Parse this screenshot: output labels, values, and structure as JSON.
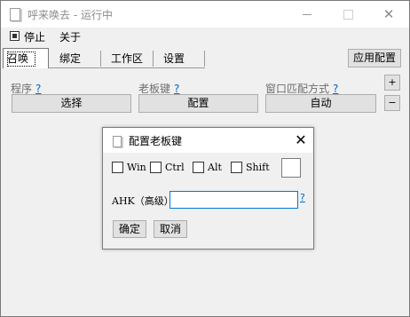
{
  "window": {
    "title": "呼来唤去 - 运行中"
  },
  "menu": {
    "items": [
      "停止",
      "关于"
    ]
  },
  "tabs": [
    "召唤",
    "绑定",
    "工作区",
    "设置"
  ],
  "toolbar": {
    "apply_label": "应用配置",
    "add_label": "+",
    "remove_label": "−"
  },
  "fields": {
    "program": {
      "label": "程序",
      "help": "?",
      "button": "选择"
    },
    "boss_key": {
      "label": "老板键",
      "help": "?",
      "button": "配置"
    },
    "window_match": {
      "label": "窗口匹配方式",
      "help": "?",
      "button": "自动"
    }
  },
  "dialog": {
    "title": "配置老板键",
    "close_glyph": "✕",
    "modifiers": [
      "Win",
      "Ctrl",
      "Alt",
      "Shift"
    ],
    "ahk_label": "AHK（高级）",
    "ahk_value": "",
    "help": "?",
    "ok_label": "确定",
    "cancel_label": "取消"
  }
}
